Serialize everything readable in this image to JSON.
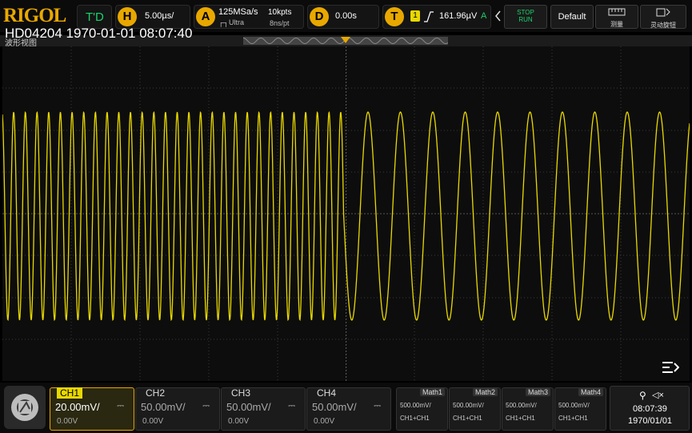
{
  "brand": "RIGOL",
  "header": {
    "t_d": "T'D",
    "h_letter": "H",
    "h_value": "5.00µs/",
    "a_letter": "A",
    "a_rate": "125MSa/s",
    "a_mode": "Ultra",
    "a_points": "10kpts",
    "a_ns": "8ns/pt",
    "d_letter": "D",
    "d_value": "0.00s",
    "t_letter": "T",
    "t_channel": "1",
    "t_level": "161.96µV",
    "t_mode": "A",
    "stop_label": "STOP",
    "run_label": "RUN",
    "default_label": "Default",
    "measure_label": "测量",
    "wizard_label": "灵动旋钮"
  },
  "overlay": {
    "title": "HD04204 1970-01-01 08:07:40",
    "subtitle": "波形视图"
  },
  "channels": [
    {
      "name": "CH1",
      "scale": "20.00mV/",
      "offset": "0.00V",
      "color": "#e8d800"
    },
    {
      "name": "CH2",
      "scale": "50.00mV/",
      "offset": "0.00V",
      "color": "#1ec4ff"
    },
    {
      "name": "CH3",
      "scale": "50.00mV/",
      "offset": "0.00V",
      "color": "#ff4fb5"
    },
    {
      "name": "CH4",
      "scale": "50.00mV/",
      "offset": "0.00V",
      "color": "#2a6cff"
    }
  ],
  "math": [
    {
      "name": "Math1",
      "value": "500.00mV/",
      "src": "CH1+CH1"
    },
    {
      "name": "Math2",
      "value": "500.00mV/",
      "src": "CH1+CH1"
    },
    {
      "name": "Math3",
      "value": "500.00mV/",
      "src": "CH1+CH1"
    },
    {
      "name": "Math4",
      "value": "500.00mV/",
      "src": "CH1+CH1"
    }
  ],
  "status": {
    "time": "08:07:39",
    "date": "1970/01/01"
  },
  "colors": {
    "accent": "#e8a800",
    "trace": "#e8d800",
    "grid": "#3a3a3a"
  }
}
